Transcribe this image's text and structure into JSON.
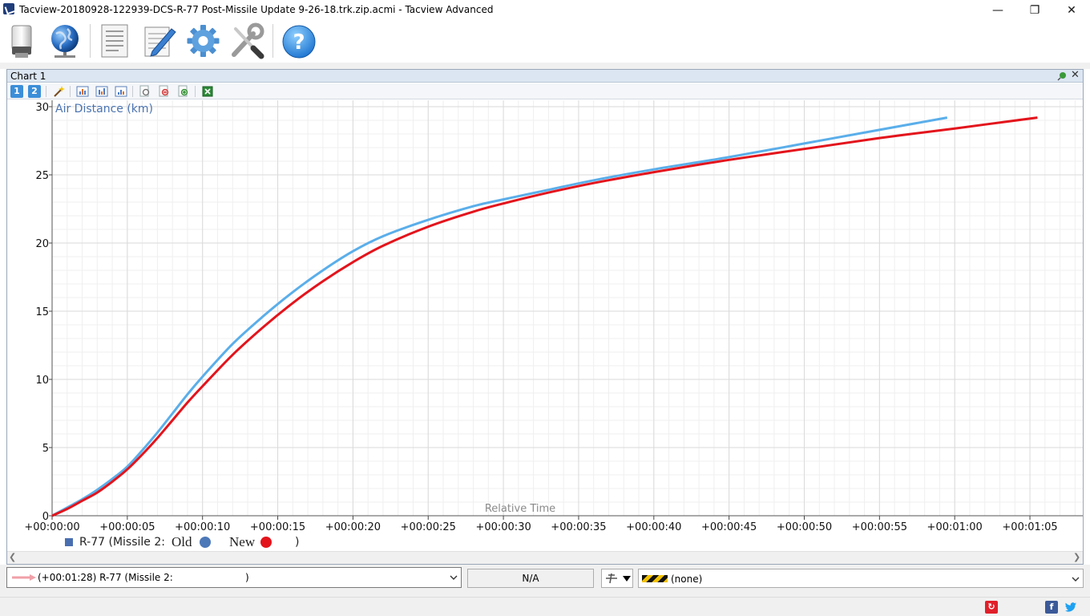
{
  "window": {
    "title": "Tacview-20180928-122939-DCS-R-77 Post-Missile Update 9-26-18.trk.zip.acmi - Tacview Advanced",
    "minimize_glyph": "—",
    "maximize_glyph": "❐",
    "close_glyph": "✕"
  },
  "toolbar": {
    "buttons": [
      {
        "name": "open-file-button",
        "icon": "usb-drive-icon"
      },
      {
        "name": "globe-button",
        "icon": "globe-network-icon"
      },
      {
        "name": "flight-log-button",
        "icon": "document-icon"
      },
      {
        "name": "notes-button",
        "icon": "notepad-pen-icon"
      },
      {
        "name": "settings-button",
        "icon": "gear-icon"
      },
      {
        "name": "tools-button",
        "icon": "wrench-screwdriver-icon"
      },
      {
        "name": "help-button",
        "icon": "help-question-icon"
      }
    ]
  },
  "chart_panel": {
    "title": "Chart 1",
    "close_glyph": "✕",
    "toolbar": {
      "tab1_label": "1",
      "tab2_label": "2"
    }
  },
  "chart_data": {
    "type": "line",
    "title": "",
    "ylabel": "Air Distance (km)",
    "xlabel": "Relative Time",
    "ylim": [
      0,
      30
    ],
    "xlim_seconds": [
      0,
      67
    ],
    "yticks": [
      0,
      5,
      10,
      15,
      20,
      25,
      30
    ],
    "xtick_labels": [
      "+00:00:00",
      "+00:00:05",
      "+00:00:10",
      "+00:00:15",
      "+00:00:20",
      "+00:00:25",
      "+00:00:30",
      "+00:00:35",
      "+00:00:40",
      "+00:00:45",
      "+00:00:50",
      "+00:00:55",
      "+00:01:00",
      "+00:01:05"
    ],
    "grid": true,
    "legend_position": "bottom-left",
    "series": [
      {
        "name": "Old",
        "color": "#5aaeea",
        "x_seconds": [
          0,
          1,
          2,
          3,
          4,
          5,
          6,
          7,
          8,
          9,
          10,
          12,
          14,
          16,
          18,
          20,
          22,
          25,
          28,
          30,
          33,
          36,
          40,
          45,
          50,
          55,
          59.5
        ],
        "values": [
          0,
          0.6,
          1.2,
          1.9,
          2.7,
          3.6,
          4.8,
          6.1,
          7.5,
          8.9,
          10.2,
          12.6,
          14.6,
          16.4,
          18.0,
          19.4,
          20.5,
          21.7,
          22.7,
          23.2,
          23.9,
          24.6,
          25.4,
          26.3,
          27.3,
          28.3,
          29.2
        ]
      },
      {
        "name": "New",
        "color": "#e3141c",
        "x_seconds": [
          0,
          1,
          2,
          3,
          4,
          5,
          6,
          7,
          8,
          9,
          10,
          12,
          14,
          16,
          18,
          20,
          22,
          25,
          28,
          30,
          33,
          36,
          40,
          45,
          50,
          55,
          60,
          65.5
        ],
        "values": [
          0,
          0.5,
          1.1,
          1.7,
          2.5,
          3.4,
          4.5,
          5.7,
          7.0,
          8.3,
          9.5,
          11.8,
          13.8,
          15.6,
          17.2,
          18.6,
          19.8,
          21.2,
          22.3,
          22.9,
          23.7,
          24.4,
          25.2,
          26.1,
          26.9,
          27.7,
          28.4,
          29.2
        ]
      }
    ]
  },
  "legend": {
    "prefix": "R-77 (Missile 2:",
    "old_label": "Old",
    "old_color": "#4d78b8",
    "new_label": "New",
    "new_color": "#e3141c",
    "suffix": ")"
  },
  "bottom": {
    "object_label": "(+00:01:28) R-77 (Missile 2:",
    "object_suffix": ")",
    "na_label": "N/A",
    "none_label": "(none)"
  },
  "status": {
    "colors": {
      "red_badge": "#e0202a",
      "facebook": "#3b5998",
      "twitter": "#1da1f2"
    }
  }
}
